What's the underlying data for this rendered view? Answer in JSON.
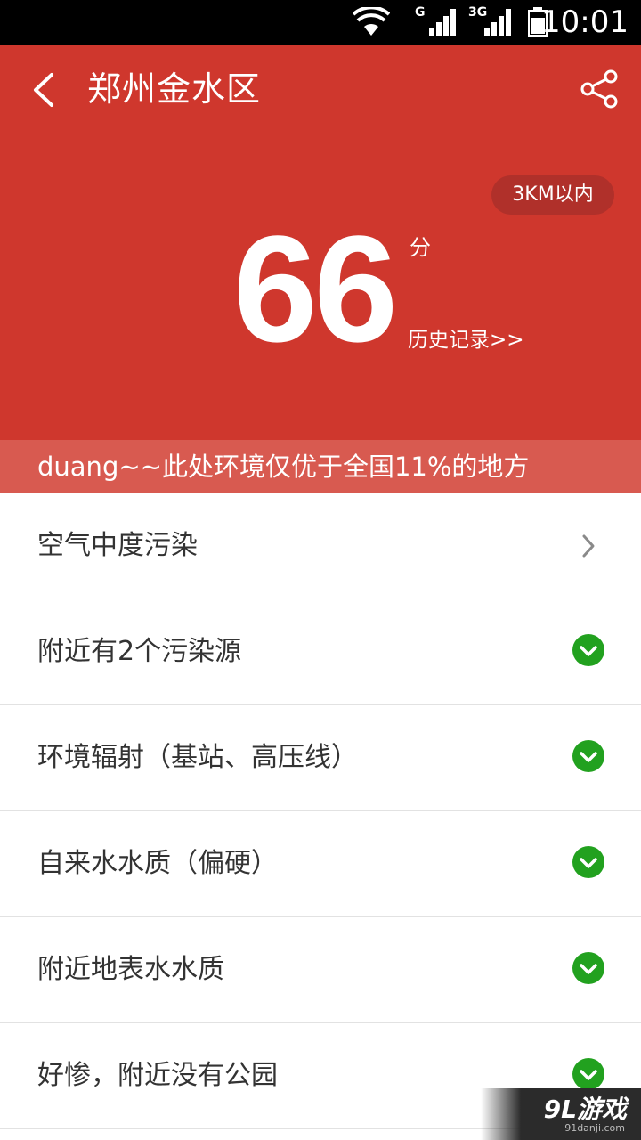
{
  "status_bar": {
    "network_1": "G",
    "network_2": "3G",
    "time": "10:01"
  },
  "header": {
    "title": "郑州金水区",
    "back_icon": "chevron-left-icon",
    "share_icon": "share-icon"
  },
  "score_panel": {
    "range_badge": "3KM以内",
    "score": "66",
    "score_unit": "分",
    "history_link": "历史记录>>",
    "banner": "duang~~此处环境仅优于全国11%的地方"
  },
  "items": [
    {
      "label": "空气中度污染",
      "status_icon": "chevron-right-icon"
    },
    {
      "label": "附近有2个污染源",
      "status_icon": "check-circle-icon"
    },
    {
      "label": "环境辐射（基站、高压线）",
      "status_icon": "check-circle-icon"
    },
    {
      "label": "自来水水质（偏硬）",
      "status_icon": "check-circle-icon"
    },
    {
      "label": "附近地表水水质",
      "status_icon": "check-circle-icon"
    },
    {
      "label": "好惨，附近没有公园",
      "status_icon": "check-circle-icon"
    }
  ],
  "watermark": {
    "logo": "9L游戏",
    "site": "91danji.com"
  },
  "colors": {
    "primary_red": "#cf372d",
    "banner_red": "#d85a50",
    "badge_red": "#b0302a",
    "check_green": "#22a11f"
  }
}
